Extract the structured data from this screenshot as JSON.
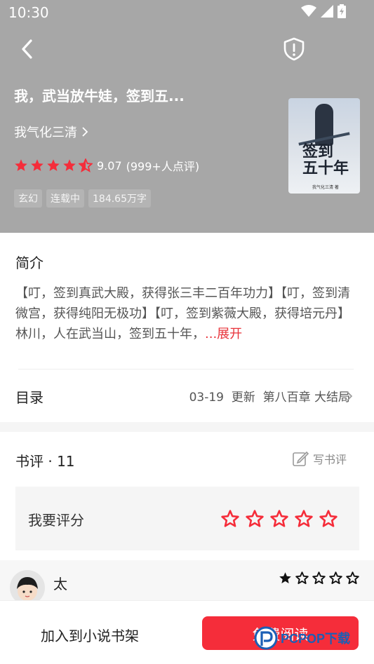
{
  "status_bar": {
    "time": "10:30"
  },
  "book": {
    "title": "我，武当放牛娃，签到五...",
    "author": "我气化三清",
    "rating": 9.07,
    "rating_text": "9.07",
    "rating_count": "(999+人点评)",
    "stars_shown": 4.5,
    "tags": [
      "玄幻",
      "连载中",
      "184.65万字"
    ],
    "cover": {
      "title_line1": "签到",
      "title_line2": "五十年",
      "author": "我气化三清 著"
    }
  },
  "intro": {
    "heading": "简介",
    "text": "【叮，签到真武大殿，获得张三丰二百年功力】【叮，签到清微宫，获得纯阳无极功】【叮，签到紫薇大殿，获得培元丹】林川，人在武当山，签到五十年，",
    "more": "...展开"
  },
  "toc": {
    "label": "目录",
    "update_date": "03-19",
    "update_word": "更新",
    "latest_chapter": "第八百章 大结局"
  },
  "reviews": {
    "heading": "书评 · 11",
    "write_label": "写书评",
    "rate_label": "我要评分",
    "comment": {
      "username": "太",
      "stars": 1
    }
  },
  "bottom_bar": {
    "add_shelf": "加入到小说书架",
    "read_now": "免费阅读"
  },
  "watermark": {
    "text": "PCPOP下载"
  },
  "colors": {
    "accent": "#f52d3a",
    "header_bg": "#a7a7a7"
  }
}
